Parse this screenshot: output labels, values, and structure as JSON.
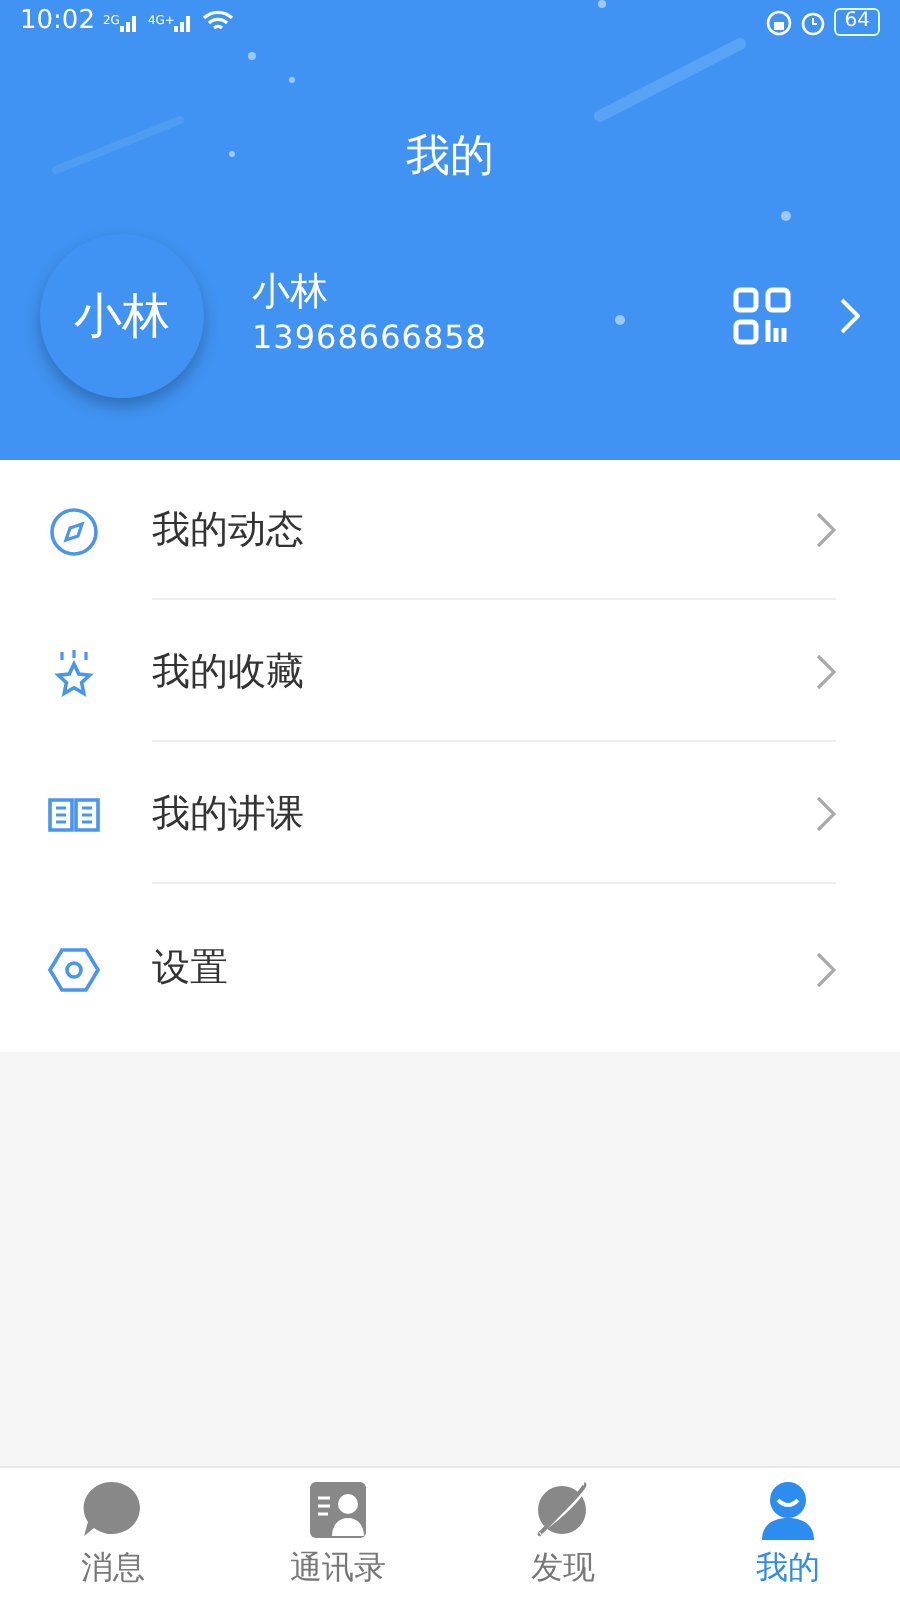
{
  "status_bar": {
    "time": "10:02",
    "network_1": "2G",
    "network_2": "4G+",
    "battery": "64"
  },
  "header": {
    "title": "我的"
  },
  "profile": {
    "avatar_text": "小林",
    "name": "小林",
    "phone": "13968666858"
  },
  "menu": [
    {
      "kind": "compass",
      "label": "我的动态"
    },
    {
      "kind": "star",
      "label": "我的收藏"
    },
    {
      "kind": "book",
      "label": "我的讲课"
    },
    {
      "kind": "settings",
      "label": "设置"
    }
  ],
  "tabs": [
    {
      "kind": "chat",
      "label": "消息",
      "selected": false
    },
    {
      "kind": "contacts",
      "label": "通讯录",
      "selected": false
    },
    {
      "kind": "planet",
      "label": "发现",
      "selected": false
    },
    {
      "kind": "person",
      "label": "我的",
      "selected": true
    }
  ]
}
